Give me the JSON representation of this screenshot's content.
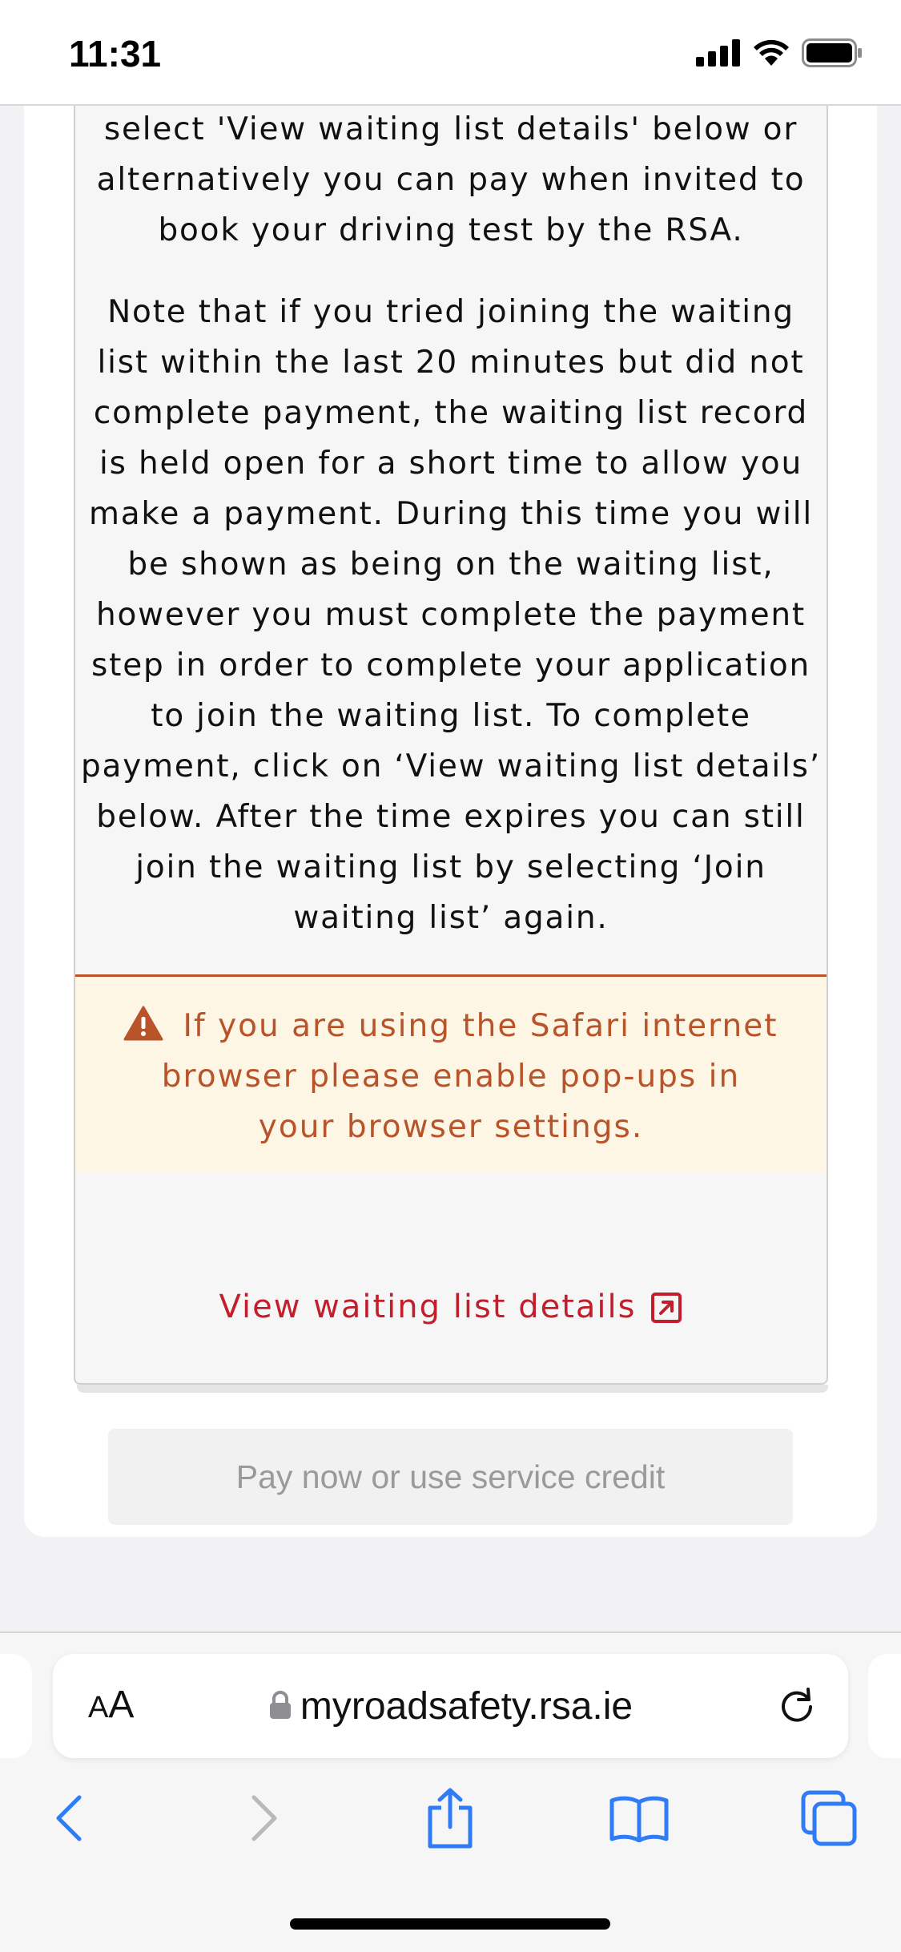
{
  "status_bar": {
    "time": "11:31"
  },
  "content": {
    "paragraph1": "select 'View waiting list details' below or alternatively you can pay when invited to book your driving test by the RSA.",
    "paragraph2": "Note that if you tried joining the waiting list within the last 20 minutes but did not complete payment, the waiting list record is held open for a short time to allow you make a payment. During this time you will be shown as being on the waiting list, however you must complete the payment step in order to complete your application to join the waiting list. To complete payment, click on ‘View waiting list details’ below. After the time expires you can still join the waiting list by selecting ‘Join waiting list’ again.",
    "warning": "If you are using the Safari internet browser please enable pop-ups in your browser settings.",
    "view_link": "View waiting list details",
    "pay_button": "Pay now or use service credit"
  },
  "safari": {
    "aa_small": "A",
    "aa_big": "A",
    "url": "myroadsafety.rsa.ie"
  },
  "colors": {
    "warning_text": "#b9542a",
    "warning_bg": "#fdf6e5",
    "link": "#c21f2d",
    "safari_blue": "#2f7cf6"
  },
  "icons": [
    "signal-icon",
    "wifi-icon",
    "battery-icon",
    "warning-icon",
    "external-link-icon",
    "lock-icon",
    "reload-icon",
    "back-icon",
    "forward-icon",
    "share-icon",
    "bookmarks-icon",
    "tabs-icon"
  ]
}
